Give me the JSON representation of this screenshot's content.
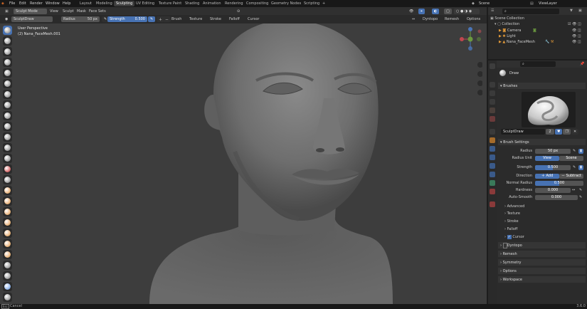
{
  "menu": {
    "file": "File",
    "edit": "Edit",
    "render": "Render",
    "window": "Window",
    "help": "Help"
  },
  "workspace_tabs": [
    "Layout",
    "Modeling",
    "Sculpting",
    "UV Editing",
    "Texture Paint",
    "Shading",
    "Animation",
    "Rendering",
    "Compositing",
    "Geometry Nodes",
    "Scripting",
    "+"
  ],
  "active_tab": "Sculpting",
  "scene": "Scene",
  "view_layer": "ViewLayer",
  "viewport_header": {
    "mode": "Sculpt Mode",
    "view": "View",
    "sculpt": "Sculpt",
    "mask": "Mask",
    "face_sets": "Face Sets",
    "dyntopo": "Dyntopo",
    "remesh": "Remesh",
    "options": "Options"
  },
  "tool_header": {
    "brush": "SculptDraw",
    "radius_label": "Radius",
    "radius_value": "50 px",
    "strength_label": "Strength",
    "strength_value": "0.500",
    "brush_menu": "Brush",
    "texture_menu": "Texture",
    "stroke_menu": "Stroke",
    "falloff_menu": "Falloff",
    "cursor_menu": "Cursor"
  },
  "viewport_overlay": {
    "perspective": "User Perspective",
    "object": "(2) Nana_FaceMesh.001"
  },
  "outliner": {
    "title": "Scene Collection",
    "items": [
      {
        "label": "Collection",
        "icon": "collection-icon"
      },
      {
        "label": "Camera",
        "icon": "camera-icon"
      },
      {
        "label": "Light",
        "icon": "light-icon"
      },
      {
        "label": "Nana_FaceMesh",
        "icon": "mesh-icon"
      }
    ]
  },
  "properties": {
    "tool_name": "Draw",
    "brushes_panel": "Brushes",
    "brush_name": "SculptDraw",
    "brush_users": "2",
    "brush_settings_panel": "Brush Settings",
    "radius_label": "Radius",
    "radius_value": "50 px",
    "radius_unit_label": "Radius Unit",
    "radius_unit_view": "View",
    "radius_unit_scene": "Scene",
    "strength_label": "Strength",
    "strength_value": "0.500",
    "direction_label": "Direction",
    "direction_add": "Add",
    "direction_subtract": "Subtract",
    "normal_radius_label": "Normal Radius",
    "normal_radius_value": "0.500",
    "hardness_label": "Hardness",
    "hardness_value": "0.000",
    "auto_smooth_label": "Auto-Smooth",
    "auto_smooth_value": "0.000",
    "subpanels": [
      "Advanced",
      "Texture",
      "Stroke",
      "Falloff",
      "Cursor"
    ],
    "panels": [
      "Dyntopo",
      "Remesh",
      "Symmetry",
      "Options",
      "Workspace"
    ]
  },
  "status": {
    "cancel": "Cancel",
    "version": "3.6.0"
  },
  "colors": {
    "accent": "#4772b3",
    "bg": "#1d1d1d",
    "viewport": "#3d3d3d"
  }
}
